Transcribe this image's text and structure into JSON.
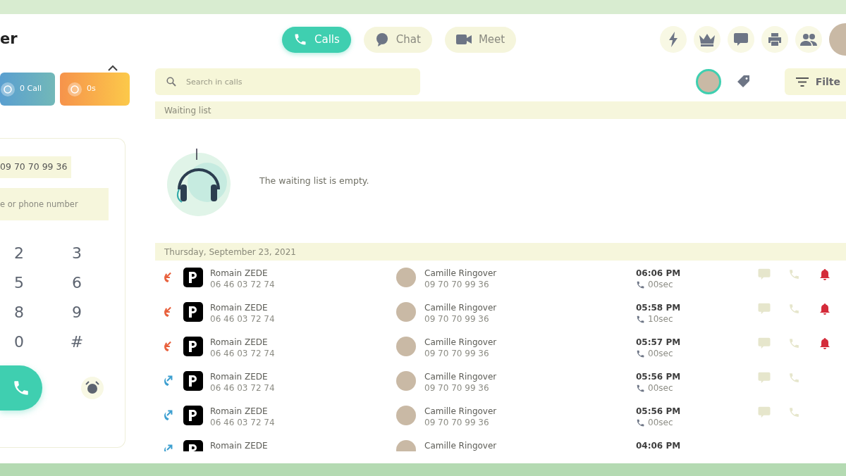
{
  "app_title": "er",
  "tabs": [
    {
      "label": "Calls",
      "selected": true,
      "kind": "phone"
    },
    {
      "label": "Chat",
      "selected": false,
      "kind": "chat"
    },
    {
      "label": "Meet",
      "selected": false,
      "kind": "video"
    }
  ],
  "stats": [
    {
      "label": "0 Call",
      "kind": "calls"
    },
    {
      "label": "0s",
      "kind": "duration"
    }
  ],
  "dialer": {
    "caller_number": "09 70 70 99 36",
    "placeholder": "e or phone number",
    "keys": [
      "2",
      "3",
      "5",
      "6",
      "8",
      "9",
      "0",
      "#"
    ]
  },
  "search": {
    "placeholder": "Search in calls"
  },
  "filter_label": "Filte",
  "waiting": {
    "title": "Waiting list",
    "empty_text": "The waiting list is empty."
  },
  "date_header": "Thursday, September 23, 2021",
  "calls": [
    {
      "kind": "missed",
      "contact": "Romain ZEDE",
      "contact_number": "06 46 03 72 74",
      "agent": "Camille Ringover",
      "agent_number": "09 70 70 99 36",
      "time": "06:06 PM",
      "duration": "00sec",
      "alert": true
    },
    {
      "kind": "missed",
      "contact": "Romain ZEDE",
      "contact_number": "06 46 03 72 74",
      "agent": "Camille Ringover",
      "agent_number": "09 70 70 99 36",
      "time": "05:58 PM",
      "duration": "10sec",
      "alert": true
    },
    {
      "kind": "missed",
      "contact": "Romain ZEDE",
      "contact_number": "06 46 03 72 74",
      "agent": "Camille Ringover",
      "agent_number": "09 70 70 99 36",
      "time": "05:57 PM",
      "duration": "00sec",
      "alert": true
    },
    {
      "kind": "outgoing",
      "contact": "Romain ZEDE",
      "contact_number": "06 46 03 72 74",
      "agent": "Camille Ringover",
      "agent_number": "09 70 70 99 36",
      "time": "05:56 PM",
      "duration": "00sec",
      "alert": false
    },
    {
      "kind": "outgoing",
      "contact": "Romain ZEDE",
      "contact_number": "06 46 03 72 74",
      "agent": "Camille Ringover",
      "agent_number": "09 70 70 99 36",
      "time": "05:56 PM",
      "duration": "00sec",
      "alert": false
    },
    {
      "kind": "outgoing",
      "contact": "Romain ZEDE",
      "agent": "Camille Ringover",
      "time": "04:06 PM",
      "alert": false
    }
  ]
}
